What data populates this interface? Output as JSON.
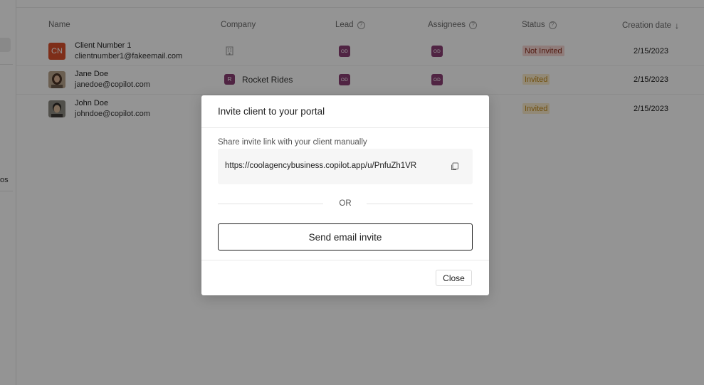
{
  "sidebar": {
    "fragment_text": "os"
  },
  "table": {
    "headers": {
      "name": "Name",
      "company": "Company",
      "lead": "Lead",
      "assignees": "Assignees",
      "status": "Status",
      "creation_date": "Creation date"
    },
    "rows": [
      {
        "avatar_initials": "CN",
        "name": "Client Number 1",
        "email": "clientnumber1@fakeemail.com",
        "company_name": "",
        "lead_initials": "OD",
        "assignee_initials": "OD",
        "status": "Not Invited",
        "creation_date": "2/15/2023"
      },
      {
        "name": "Jane Doe",
        "email": "janedoe@copilot.com",
        "company_badge": "R",
        "company_name": "Rocket Rides",
        "lead_initials": "OD",
        "assignee_initials": "OD",
        "status": "Invited",
        "creation_date": "2/15/2023"
      },
      {
        "name": "John Doe",
        "email": "johndoe@copilot.com",
        "company_name": "",
        "status": "Invited",
        "creation_date": "2/15/2023"
      }
    ]
  },
  "modal": {
    "title": "Invite client to your portal",
    "share_label": "Share invite link with your client manually",
    "invite_link": "https://coolagencybusiness.copilot.app/u/PnfuZh1VR",
    "or_text": "OR",
    "send_button": "Send email invite",
    "close_button": "Close"
  },
  "colors": {
    "overlay": "rgba(0,0,0,0.42)",
    "avatar_cn": "#d9502c",
    "od_badge": "#8a3e74",
    "status_not_invited_bg": "#f7d6d2",
    "status_not_invited_text": "#8c2c1c",
    "status_invited_bg": "#fbeccb",
    "status_invited_text": "#c28a1a"
  }
}
